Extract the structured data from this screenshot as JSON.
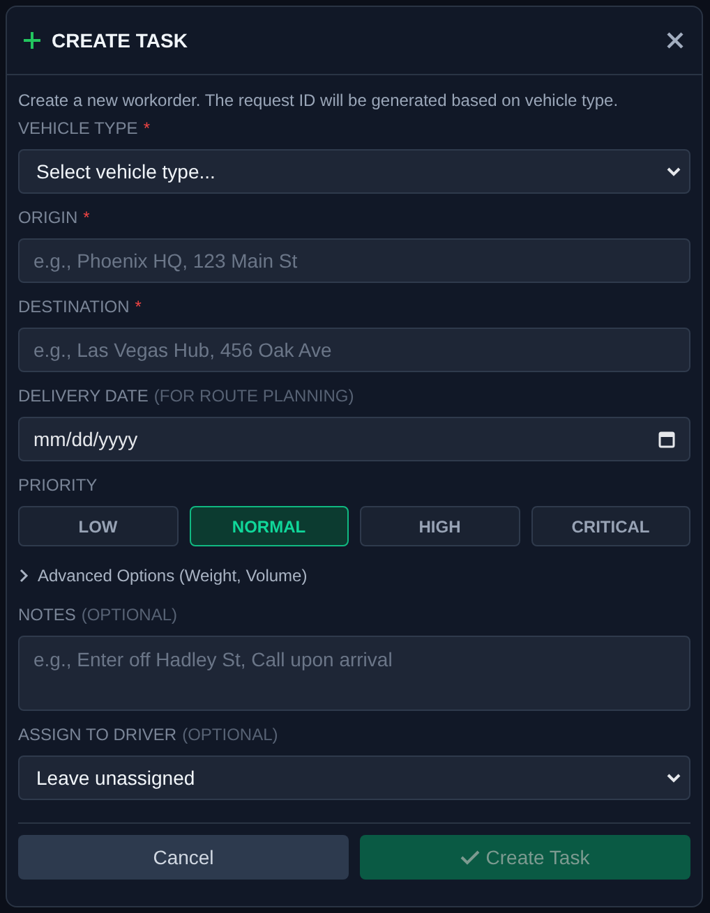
{
  "dialog": {
    "title": "CREATE TASK",
    "description": "Create a new workorder. The request ID will be generated based on vehicle type."
  },
  "fields": [
    {
      "kind": "select",
      "label": "VEHICLE TYPE",
      "required_mark": "*",
      "value": "Select vehicle type..."
    },
    {
      "kind": "text",
      "label": "ORIGIN",
      "required_mark": "*",
      "placeholder": "e.g., Phoenix HQ, 123 Main St"
    },
    {
      "kind": "text",
      "label": "DESTINATION",
      "required_mark": "*",
      "placeholder": "e.g., Las Vegas Hub, 456 Oak Ave"
    },
    {
      "kind": "date",
      "label": "DELIVERY DATE",
      "hint": "(FOR ROUTE PLANNING)",
      "placeholder": "mm/dd/yyyy"
    }
  ],
  "priority": {
    "label": "PRIORITY",
    "options": [
      {
        "label": "LOW",
        "selected": false
      },
      {
        "label": "NORMAL",
        "selected": true
      },
      {
        "label": "HIGH",
        "selected": false
      },
      {
        "label": "CRITICAL",
        "selected": false
      }
    ]
  },
  "advanced": {
    "label": "Advanced Options (Weight, Volume)",
    "expanded": false
  },
  "fields_after": [
    {
      "kind": "textarea",
      "label": "NOTES",
      "hint": "(OPTIONAL)",
      "placeholder": "e.g., Enter off Hadley St, Call upon arrival"
    },
    {
      "kind": "select",
      "label": "ASSIGN TO DRIVER",
      "hint": "(OPTIONAL)",
      "value": "Leave unassigned"
    }
  ],
  "buttons": {
    "cancel": {
      "label": "Cancel"
    },
    "submit": {
      "label": "Create Task",
      "disabled": true
    }
  }
}
